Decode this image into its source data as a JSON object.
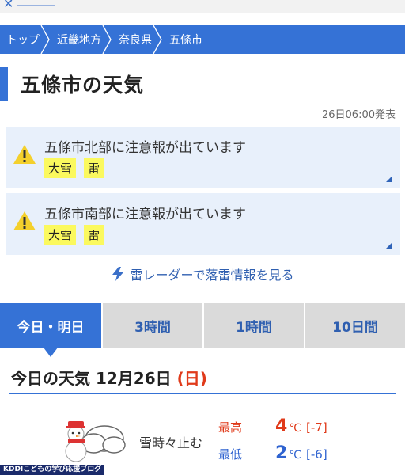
{
  "breadcrumb": [
    "トップ",
    "近畿地方",
    "奈良県",
    "五條市"
  ],
  "title": "五條市の天気",
  "announcement": "26日06:00発表",
  "alerts": [
    {
      "message": "五條市北部に注意報が出ています",
      "tags": [
        "大雪",
        "雷"
      ]
    },
    {
      "message": "五條市南部に注意報が出ています",
      "tags": [
        "大雪",
        "雷"
      ]
    }
  ],
  "radar_link": "雷レーダーで落雷情報を見る",
  "tabs": [
    "今日・明日",
    "3時間",
    "1時間",
    "10日間"
  ],
  "today": {
    "label": "今日の天気",
    "date": "12月26日",
    "dow_open": "(",
    "dow": "日",
    "dow_close": ")",
    "weather": "雪時々止む",
    "high_label": "最高",
    "high": "4",
    "high_diff": "[-7]",
    "low_label": "最低",
    "low": "2",
    "low_diff": "[-6]",
    "unit": "℃"
  },
  "badge": "KDDIこどもの学び応援ブログ",
  "colors": {
    "primary": "#3572d6",
    "alert_bg": "#e8f0fb",
    "tag_bg": "#fbf95e",
    "high": "#e03a1a",
    "low": "#2f63d0"
  }
}
